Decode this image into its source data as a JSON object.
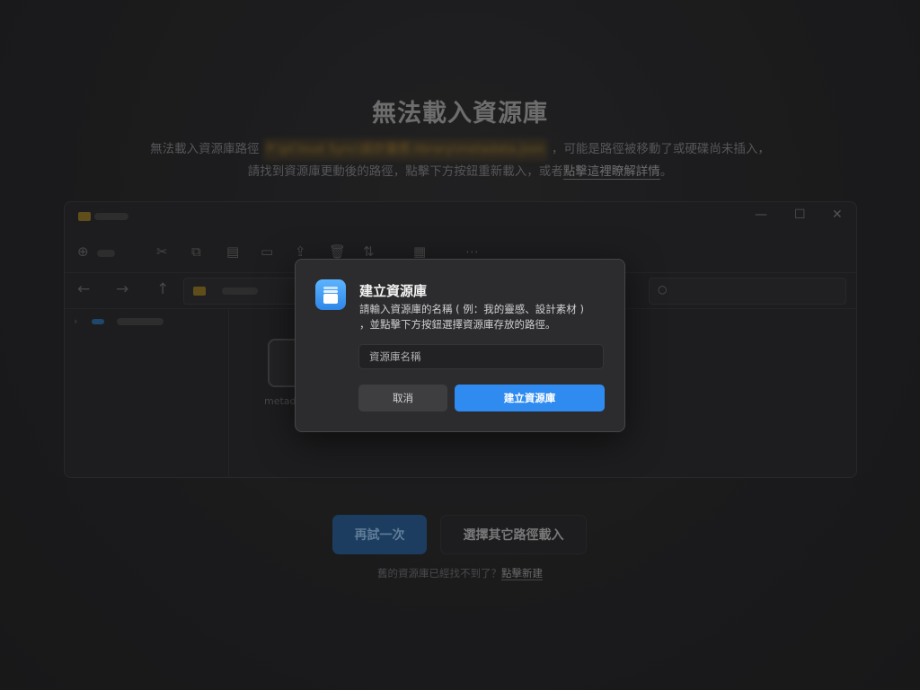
{
  "background_page": {
    "title": "無法載入資源庫",
    "desc_line1_prefix": "無法載入資源庫路徑",
    "path_blurred": "P:\\pCloud Sync\\設計靈感.library\\metadata.json",
    "desc_line1_suffix": "，可能是路徑被移動了或硬碟尚未插入，",
    "desc_line2_prefix": "請找到資源庫更動後的路徑，點擊下方按鈕重新載入，或者",
    "desc_link": "點擊這裡瞭解詳情",
    "desc_line2_suffix": "。",
    "retry_label": "再試一次",
    "choose_other_label": "選擇其它路徑載入",
    "bottom_note_prefix": "舊的資源庫已經找不到了？",
    "bottom_note_link": "點擊新建",
    "file_name": "metada"
  },
  "dialog": {
    "title": "建立資源庫",
    "description": "請輸入資源庫的名稱 ( 例：我的靈感、設計素材 ) ，並點擊下方按鈕選擇資源庫存放的路徑。",
    "input_placeholder": "資源庫名稱",
    "input_value": "",
    "cancel_label": "取消",
    "create_label": "建立資源庫"
  },
  "icons": {
    "dialog_icon": "library-icon",
    "window_controls": [
      "minimize-icon",
      "maximize-icon",
      "close-icon"
    ],
    "toolbar": [
      "new-icon",
      "cut-icon",
      "copy-icon",
      "paste-icon",
      "rename-icon",
      "share-icon",
      "delete-icon",
      "sort-icon",
      "view-icon",
      "more-icon"
    ],
    "nav": [
      "back-icon",
      "forward-icon",
      "up-icon",
      "search-icon"
    ]
  },
  "colors": {
    "accent": "#2f8bf0",
    "background": "#232325",
    "dialog_bg": "#2c2c2e"
  }
}
